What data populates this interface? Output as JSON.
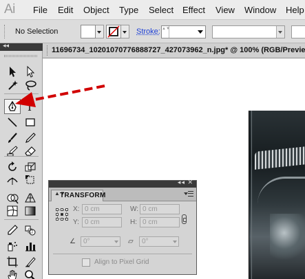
{
  "app": {
    "logo": "Ai"
  },
  "menu": [
    "File",
    "Edit",
    "Object",
    "Type",
    "Select",
    "Effect",
    "View",
    "Window",
    "Help"
  ],
  "controlbar": {
    "selection_label": "No Selection",
    "stroke_label": "Stroke:",
    "stroke_spin_glyph": "▲▼"
  },
  "toolstrip": {
    "collapse": "◂◂"
  },
  "document": {
    "tab_title": "11696734_10201070776888727_427073962_n.jpg* @ 100% (RGB/Preview"
  },
  "tools": [
    "selection-tool",
    "direct-selection-tool",
    "magic-wand-tool",
    "lasso-tool",
    "pen-tool",
    "type-tool",
    "line-segment-tool",
    "rectangle-tool",
    "paintbrush-tool",
    "pencil-tool",
    "blob-brush-tool",
    "eraser-tool",
    "rotate-tool",
    "scale-tool",
    "width-tool",
    "free-transform-tool",
    "shape-builder-tool",
    "perspective-grid-tool",
    "mesh-tool",
    "gradient-tool",
    "eyedropper-tool",
    "blend-tool",
    "symbol-sprayer-tool",
    "column-graph-tool",
    "artboard-tool",
    "slice-tool",
    "hand-tool",
    "zoom-tool"
  ],
  "active_tool": "pen-tool",
  "annotation": {
    "color": "#d10000"
  },
  "transform_panel": {
    "panel_controls": "◂◂ ✕",
    "tab_arrow": "▲▼",
    "tab_label": "TRANSFORM",
    "x_label": "X:",
    "x_value": "0 cm",
    "y_label": "Y:",
    "y_value": "0 cm",
    "w_label": "W:",
    "w_value": "0 cm",
    "h_label": "H:",
    "h_value": "0 cm",
    "rotate_icon": "∠",
    "rotate_value": "0°",
    "shear_icon": "⏥",
    "shear_value": "0°",
    "align_label": "Align to Pixel Grid"
  }
}
